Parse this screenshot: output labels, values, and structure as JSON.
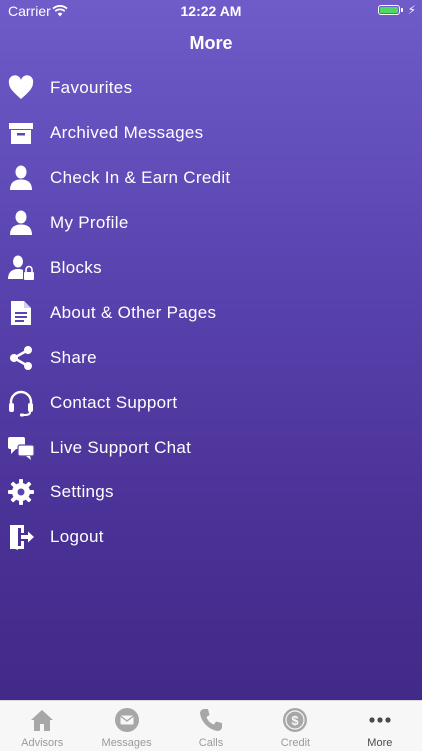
{
  "status_bar": {
    "carrier": "Carrier",
    "time": "12:22 AM",
    "battery_level": 1.0
  },
  "header": {
    "title": "More"
  },
  "menu": {
    "items": [
      {
        "label": "Favourites",
        "icon": "heart-icon"
      },
      {
        "label": "Archived Messages",
        "icon": "archive-box-icon"
      },
      {
        "label": "Check In & Earn Credit",
        "icon": "user-icon"
      },
      {
        "label": "My Profile",
        "icon": "user-icon"
      },
      {
        "label": "Blocks",
        "icon": "user-lock-icon"
      },
      {
        "label": "About & Other Pages",
        "icon": "document-icon"
      },
      {
        "label": "Share",
        "icon": "share-icon"
      },
      {
        "label": "Contact Support",
        "icon": "headset-icon"
      },
      {
        "label": "Live Support Chat",
        "icon": "chat-bubbles-icon"
      },
      {
        "label": "Settings",
        "icon": "gear-icon"
      },
      {
        "label": "Logout",
        "icon": "logout-icon"
      }
    ]
  },
  "tab_bar": {
    "tabs": [
      {
        "label": "Advisors",
        "icon": "house-icon",
        "active": false
      },
      {
        "label": "Messages",
        "icon": "envelope-icon",
        "active": false
      },
      {
        "label": "Calls",
        "icon": "phone-icon",
        "active": false
      },
      {
        "label": "Credit",
        "icon": "dollar-coin-icon",
        "active": false
      },
      {
        "label": "More",
        "icon": "ellipsis-icon",
        "active": true
      }
    ]
  },
  "colors": {
    "accent": "#5a44b0",
    "battery": "#4cd964",
    "tab_inactive": "#9a9a9a",
    "tab_active": "#4a4a4a"
  }
}
